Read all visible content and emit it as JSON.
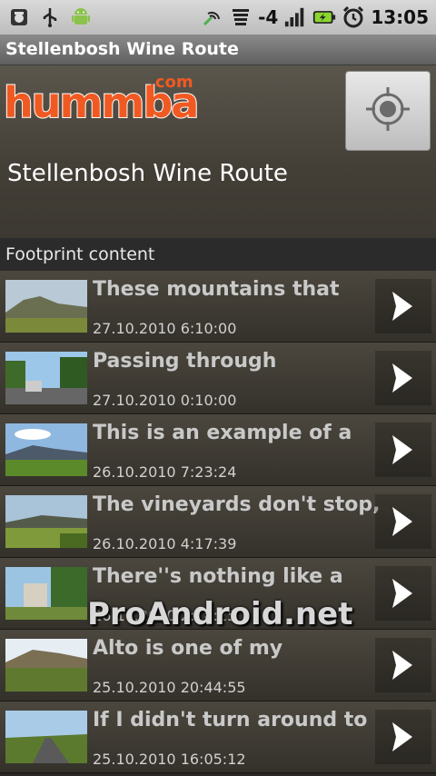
{
  "status_bar": {
    "icons": [
      "android-debug-icon",
      "usb-icon",
      "android-robot-icon",
      "sync-icon",
      "wifi-icon",
      "signal-icon",
      "battery-charging-icon",
      "alarm-clock-icon"
    ],
    "network_label": "-4",
    "time": "13:05"
  },
  "titlebar": {
    "title": "Stellenbosh Wine Route"
  },
  "header": {
    "logo_text": "hummba",
    "logo_suffix": ".com",
    "route_name": "Stellenbosh Wine Route",
    "locate_icon": "crosshair-icon"
  },
  "section": {
    "label": "Footprint content"
  },
  "list": {
    "items": [
      {
        "title": "These mountains that",
        "date": "27.10.2010 6:10:00"
      },
      {
        "title": "Passing through",
        "date": "27.10.2010 0:10:00"
      },
      {
        "title": "This is an example of a",
        "date": "26.10.2010 7:23:24"
      },
      {
        "title": "The vineyards don't stop,",
        "date": "26.10.2010 4:17:39"
      },
      {
        "title": "There''s nothing like a",
        "date": "26.10.2010 2:18:25"
      },
      {
        "title": "Alto is one of my",
        "date": "25.10.2010 20:44:55"
      },
      {
        "title": "If I didn't turn around to",
        "date": "25.10.2010 16:05:12"
      }
    ]
  },
  "watermark": "ProAndroid.net",
  "colors": {
    "brand_orange": "#f05a22",
    "titlebar": "#6e6e6e",
    "list_bg": "#3e3a33"
  }
}
